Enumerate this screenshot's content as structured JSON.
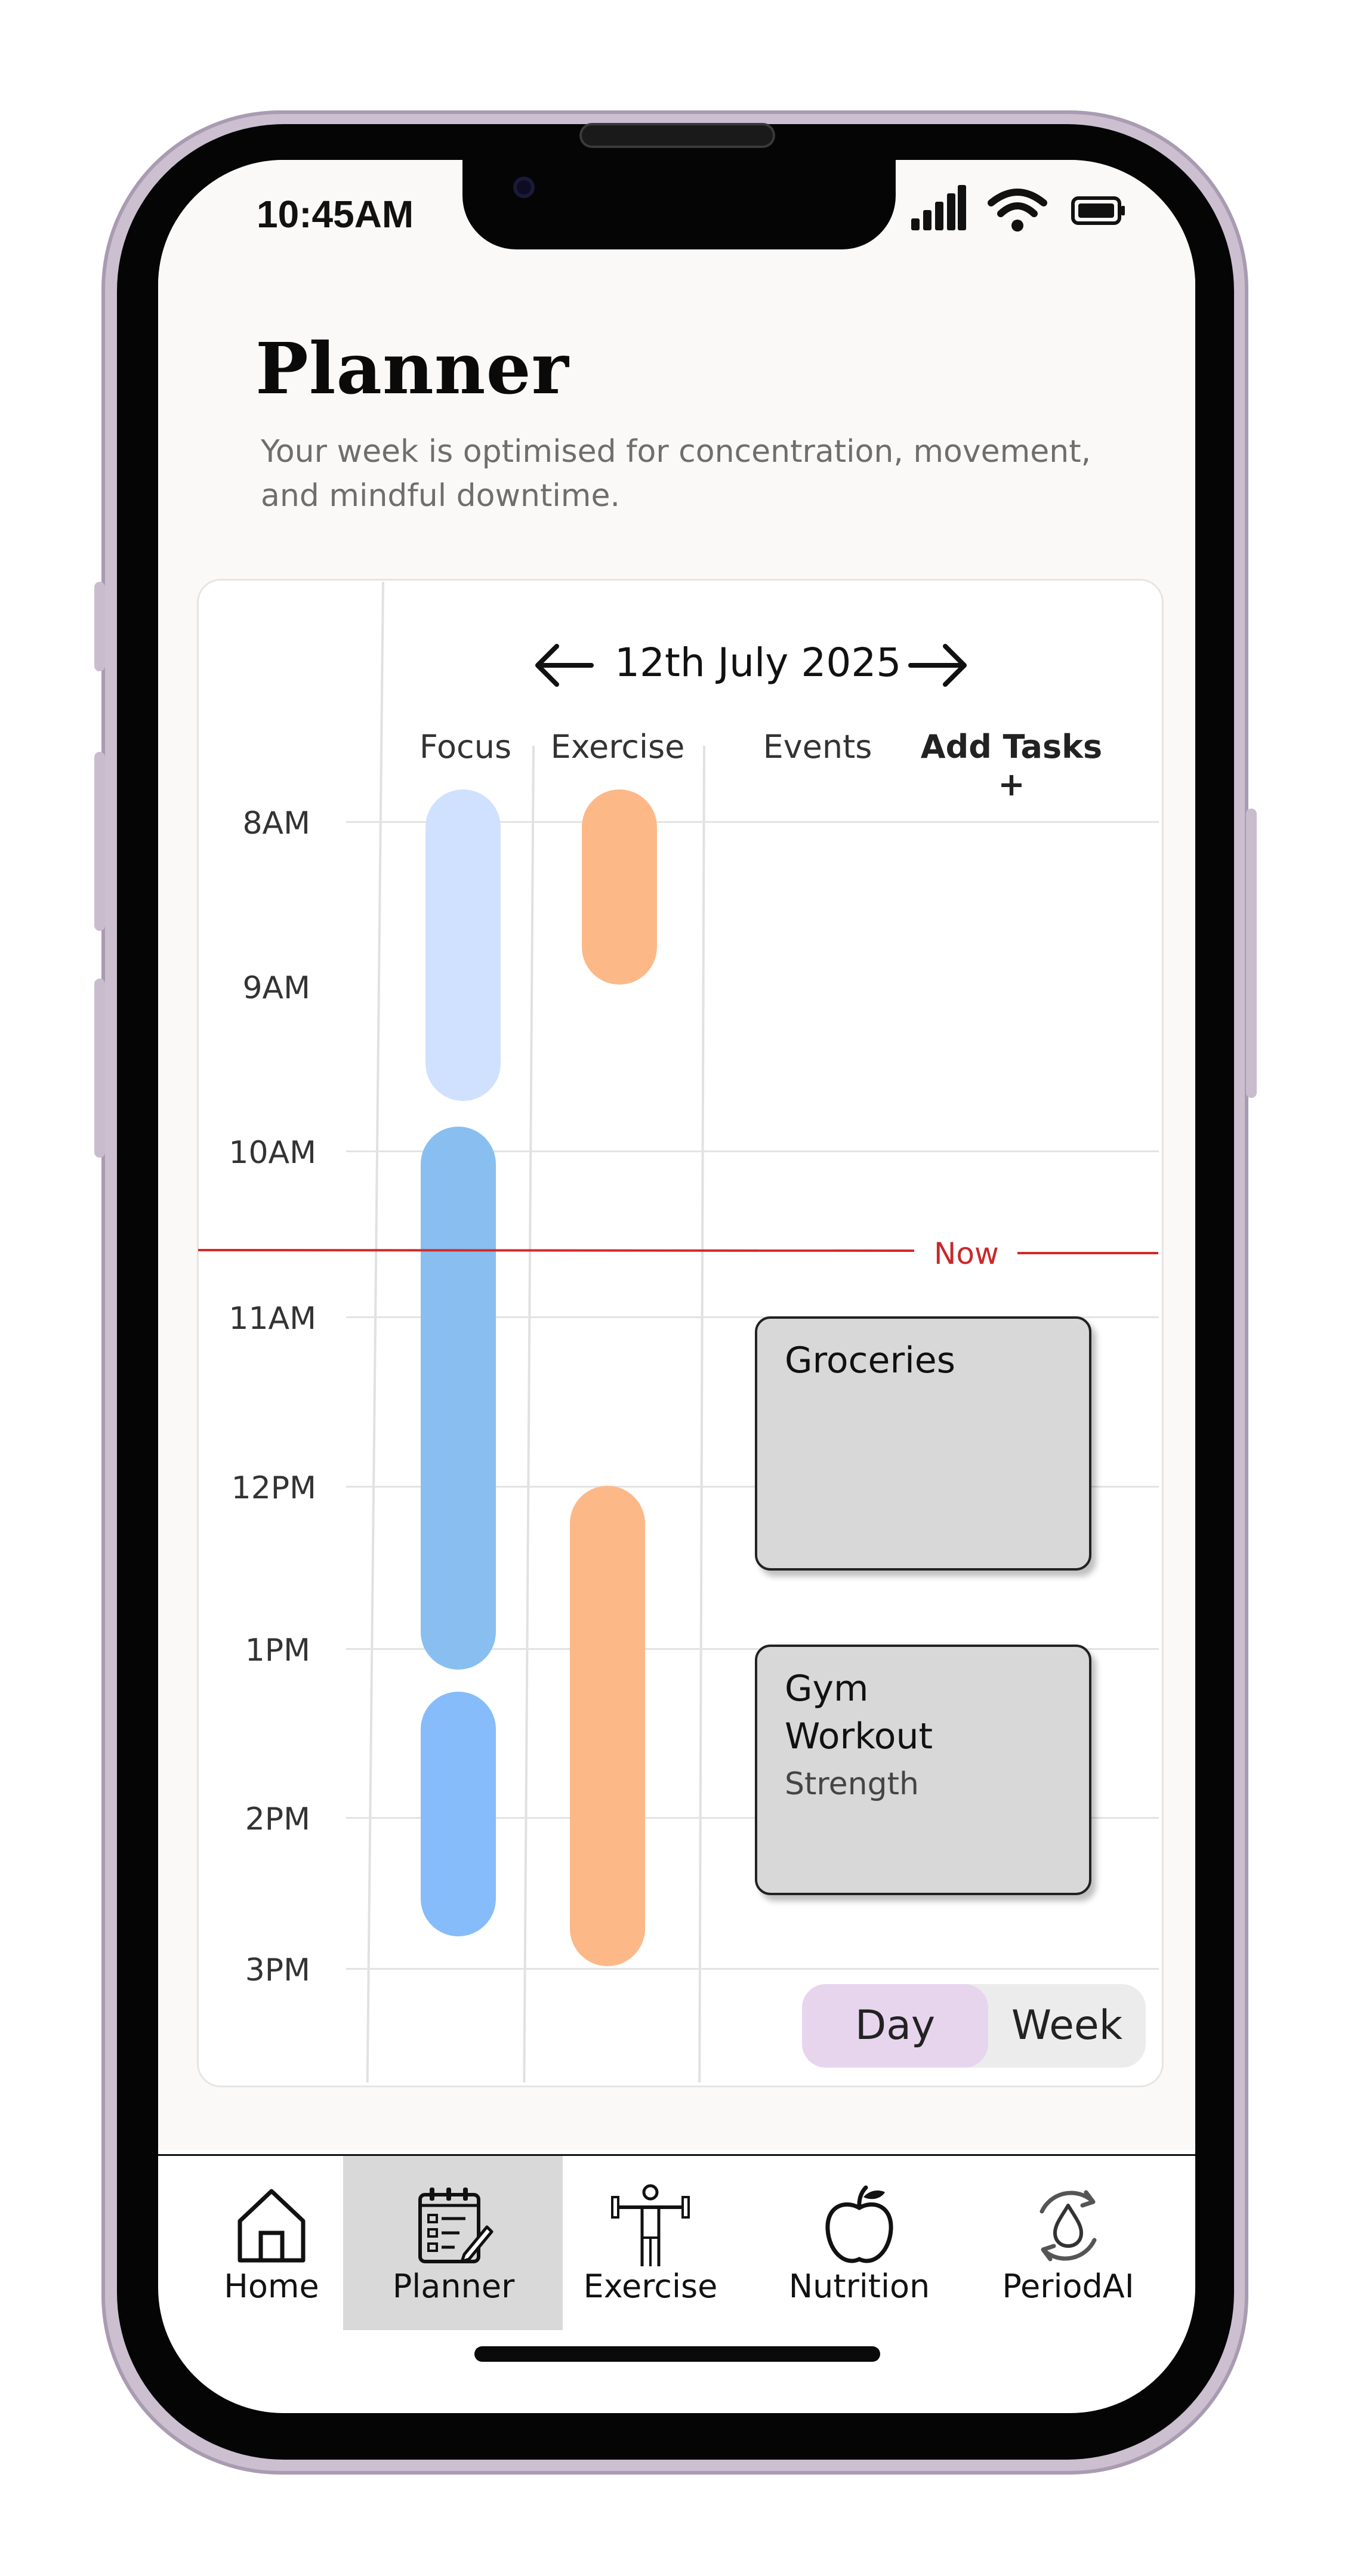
{
  "status": {
    "time": "10:45AM",
    "signal_icon": "signal-bars-icon",
    "wifi_icon": "wifi-icon",
    "battery_icon": "battery-icon"
  },
  "header": {
    "title": "Planner",
    "subtitle_line1": "Your week is optimised for concentration, movement,",
    "subtitle_line2": "and mindful downtime."
  },
  "calendar": {
    "date": "12th July 2025",
    "columns": [
      "Focus",
      "Exercise",
      "Events",
      "Add Tasks +"
    ],
    "times": [
      "8AM",
      "9AM",
      "10AM",
      "11AM",
      "12PM",
      "1PM",
      "2PM",
      "3PM"
    ],
    "now_label": "Now",
    "now_time": "10:45",
    "colors": {
      "focus_light": "#cfe1fe",
      "focus_mid": "#88bff0",
      "focus_blue": "#86bcfa",
      "exercise": "#fdb888",
      "now_line": "#d62828"
    },
    "blocks": [
      {
        "column": "Focus",
        "start": "8:00",
        "end": "9:50",
        "color": "#cfe1fe"
      },
      {
        "column": "Focus",
        "start": "9:50",
        "end": "13:10",
        "color": "#88bff0"
      },
      {
        "column": "Focus",
        "start": "13:20",
        "end": "14:45",
        "color": "#86bcfa"
      },
      {
        "column": "Exercise",
        "start": "8:00",
        "end": "9:00",
        "color": "#fdb888"
      },
      {
        "column": "Exercise",
        "start": "12:00",
        "end": "14:55",
        "color": "#fdb888"
      }
    ],
    "events": [
      {
        "title": "Groceries",
        "subtitle": ""
      },
      {
        "title_line1": "Gym",
        "title_line2": "Workout",
        "subtitle": "Strength"
      }
    ]
  },
  "view_toggle": {
    "day": "Day",
    "week": "Week",
    "selected": "Day"
  },
  "nav": {
    "items": [
      {
        "label": "Home",
        "icon": "home-icon"
      },
      {
        "label": "Planner",
        "icon": "planner-icon",
        "active": true
      },
      {
        "label": "Exercise",
        "icon": "exercise-icon"
      },
      {
        "label": "Nutrition",
        "icon": "apple-icon"
      },
      {
        "label": "PeriodAI",
        "icon": "cycle-drop-icon"
      }
    ]
  }
}
